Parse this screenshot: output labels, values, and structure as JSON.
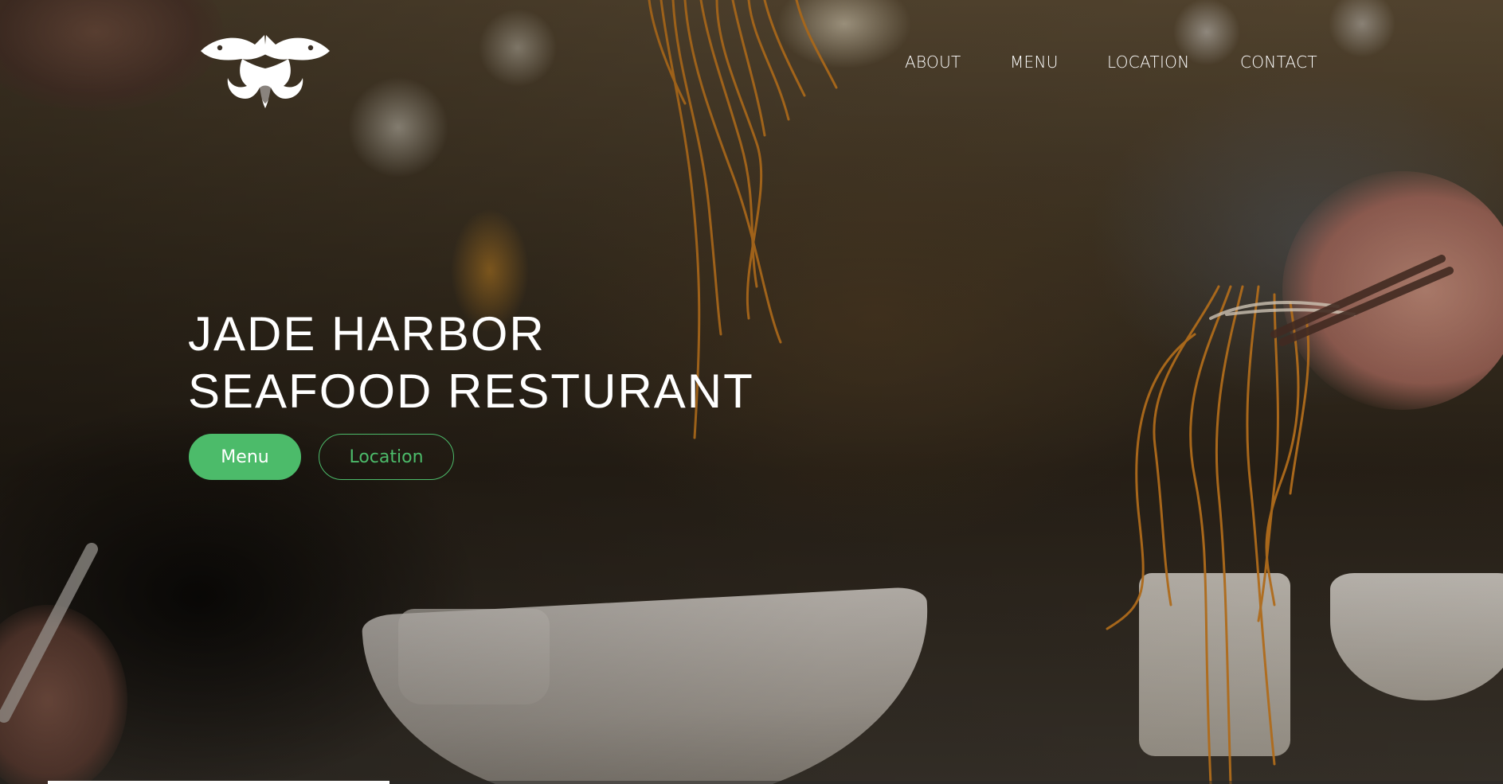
{
  "brand": {
    "logo_icon": "twin-fish-logo-icon"
  },
  "nav": {
    "items": [
      {
        "label": "ABOUT"
      },
      {
        "label": "MENU"
      },
      {
        "label": "LOCATION"
      },
      {
        "label": "CONTACT"
      }
    ]
  },
  "hero": {
    "title_line1": "JADE HARBOR",
    "title_line2": "SEAFOOD RESTURANT",
    "buttons": {
      "primary_label": "Menu",
      "secondary_label": "Location"
    }
  },
  "slider": {
    "progress": 0.235
  },
  "colors": {
    "accent": "#4cbb6a",
    "text": "#ffffff"
  }
}
